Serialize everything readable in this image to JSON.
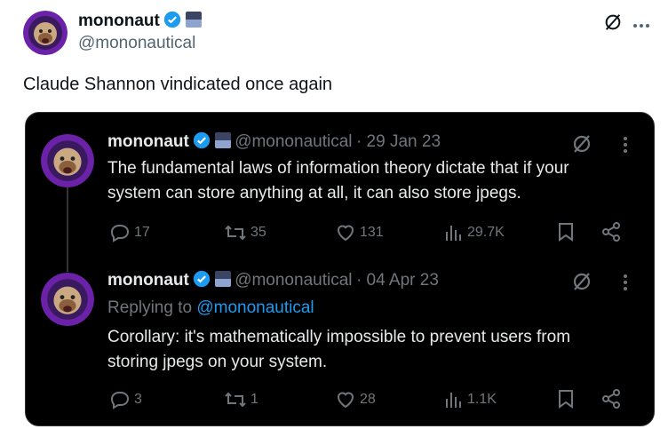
{
  "outer": {
    "name": "mononaut",
    "handle": "@mononautical",
    "text": "Claude Shannon vindicated once again"
  },
  "quoted": [
    {
      "name": "mononaut",
      "handle": "@mononautical",
      "date": "· 29 Jan 23",
      "text_line1": "The fundamental laws of information theory dictate that if your",
      "text_line2": "system can store anything at all, it can also store jpegs.",
      "replies": "17",
      "reposts": "35",
      "likes": "131",
      "views": "29.7K"
    },
    {
      "name": "mononaut",
      "handle": "@mononautical",
      "date": "· 04 Apr 23",
      "replying_prefix": "Replying to",
      "replying_to": "@mononautical",
      "text_line1": "Corollary: it's mathematically impossible to prevent users from",
      "text_line2": "storing jpegs on your system.",
      "replies": "3",
      "reposts": "1",
      "likes": "28",
      "views": "1.1K"
    }
  ],
  "colors": {
    "verified": "#1d9bf0",
    "avatar_bg": "#6b21a8",
    "card_bg": "#000000"
  },
  "icons": [
    "verified-icon",
    "flag-badge-icon",
    "grok-icon",
    "more-icon",
    "reply-icon",
    "repost-icon",
    "like-icon",
    "views-icon",
    "bookmark-icon",
    "share-icon"
  ]
}
